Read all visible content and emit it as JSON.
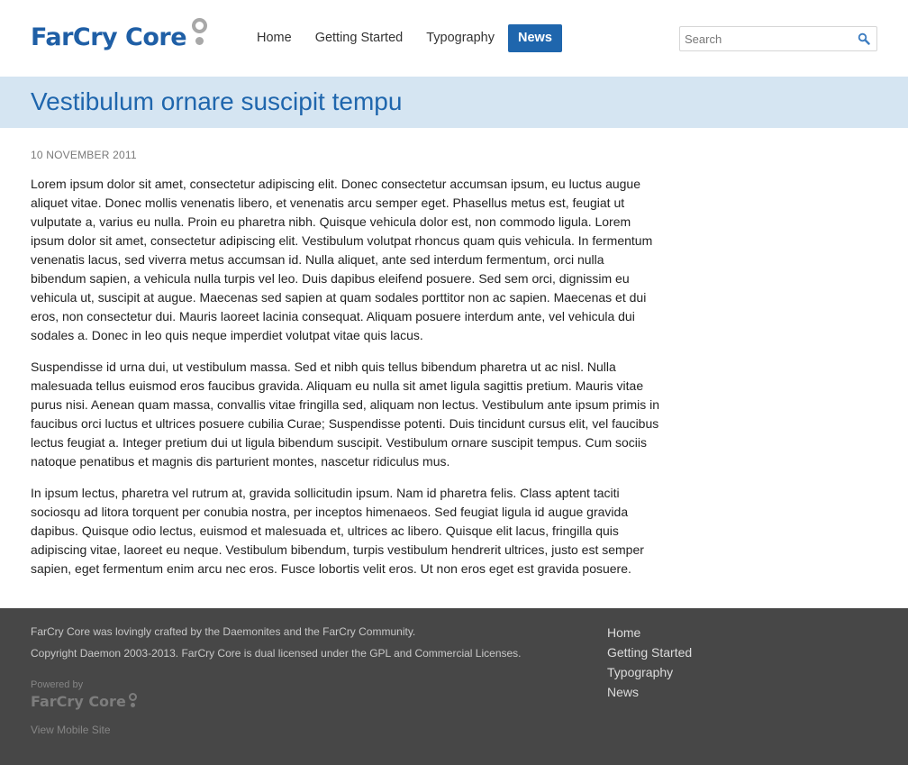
{
  "header": {
    "logo_text": "FarCry Core",
    "nav": [
      {
        "label": "Home",
        "active": false
      },
      {
        "label": "Getting Started",
        "active": false
      },
      {
        "label": "Typography",
        "active": false
      },
      {
        "label": "News",
        "active": true
      }
    ],
    "search": {
      "placeholder": "Search",
      "value": ""
    }
  },
  "page": {
    "title": "Vestibulum ornare suscipit tempu",
    "date": "10 NOVEMBER 2011",
    "paragraphs": [
      "Lorem ipsum dolor sit amet, consectetur adipiscing elit. Donec consectetur accumsan ipsum, eu luctus augue aliquet vitae. Donec mollis venenatis libero, et venenatis arcu semper eget. Phasellus metus est, feugiat ut vulputate a, varius eu nulla. Proin eu pharetra nibh. Quisque vehicula dolor est, non commodo ligula. Lorem ipsum dolor sit amet, consectetur adipiscing elit. Vestibulum volutpat rhoncus quam quis vehicula. In fermentum venenatis lacus, sed viverra metus accumsan id. Nulla aliquet, ante sed interdum fermentum, orci nulla bibendum sapien, a vehicula nulla turpis vel leo. Duis dapibus eleifend posuere. Sed sem orci, dignissim eu vehicula ut, suscipit at augue. Maecenas sed sapien at quam sodales porttitor non ac sapien. Maecenas et dui eros, non consectetur dui. Mauris laoreet lacinia consequat. Aliquam posuere interdum ante, vel vehicula dui sodales a. Donec in leo quis neque imperdiet volutpat vitae quis lacus.",
      "Suspendisse id urna dui, ut vestibulum massa. Sed et nibh quis tellus bibendum pharetra ut ac nisl. Nulla malesuada tellus euismod eros faucibus gravida. Aliquam eu nulla sit amet ligula sagittis pretium. Mauris vitae purus nisi. Aenean quam massa, convallis vitae fringilla sed, aliquam non lectus. Vestibulum ante ipsum primis in faucibus orci luctus et ultrices posuere cubilia Curae; Suspendisse potenti. Duis tincidunt cursus elit, vel faucibus lectus feugiat a. Integer pretium dui ut ligula bibendum suscipit. Vestibulum ornare suscipit tempus. Cum sociis natoque penatibus et magnis dis parturient montes, nascetur ridiculus mus.",
      "In ipsum lectus, pharetra vel rutrum at, gravida sollicitudin ipsum. Nam id pharetra felis. Class aptent taciti sociosqu ad litora torquent per conubia nostra, per inceptos himenaeos. Sed feugiat ligula id augue gravida dapibus. Quisque odio lectus, euismod et malesuada et, ultrices ac libero. Quisque elit lacus, fringilla quis adipiscing vitae, laoreet eu neque. Vestibulum bibendum, turpis vestibulum hendrerit ultrices, justo est semper sapien, eget fermentum enim arcu nec eros. Fusce lobortis velit eros. Ut non eros eget est gravida posuere."
    ]
  },
  "footer": {
    "credit": "FarCry Core was lovingly crafted by the Daemonites and the FarCry Community.",
    "copyright": "Copyright Daemon 2003-2013. FarCry Core is dual licensed under the GPL and Commercial Licenses.",
    "powered_by": "Powered by",
    "powered_logo_text": "FarCry Core",
    "mobile_link": "View Mobile Site",
    "nav": [
      "Home",
      "Getting Started",
      "Typography",
      "News"
    ]
  },
  "colors": {
    "brand_blue": "#1f66ad",
    "title_band": "#d5e5f2",
    "footer_bg": "#474747",
    "logo_mark_gray": "#a8a8a8"
  }
}
